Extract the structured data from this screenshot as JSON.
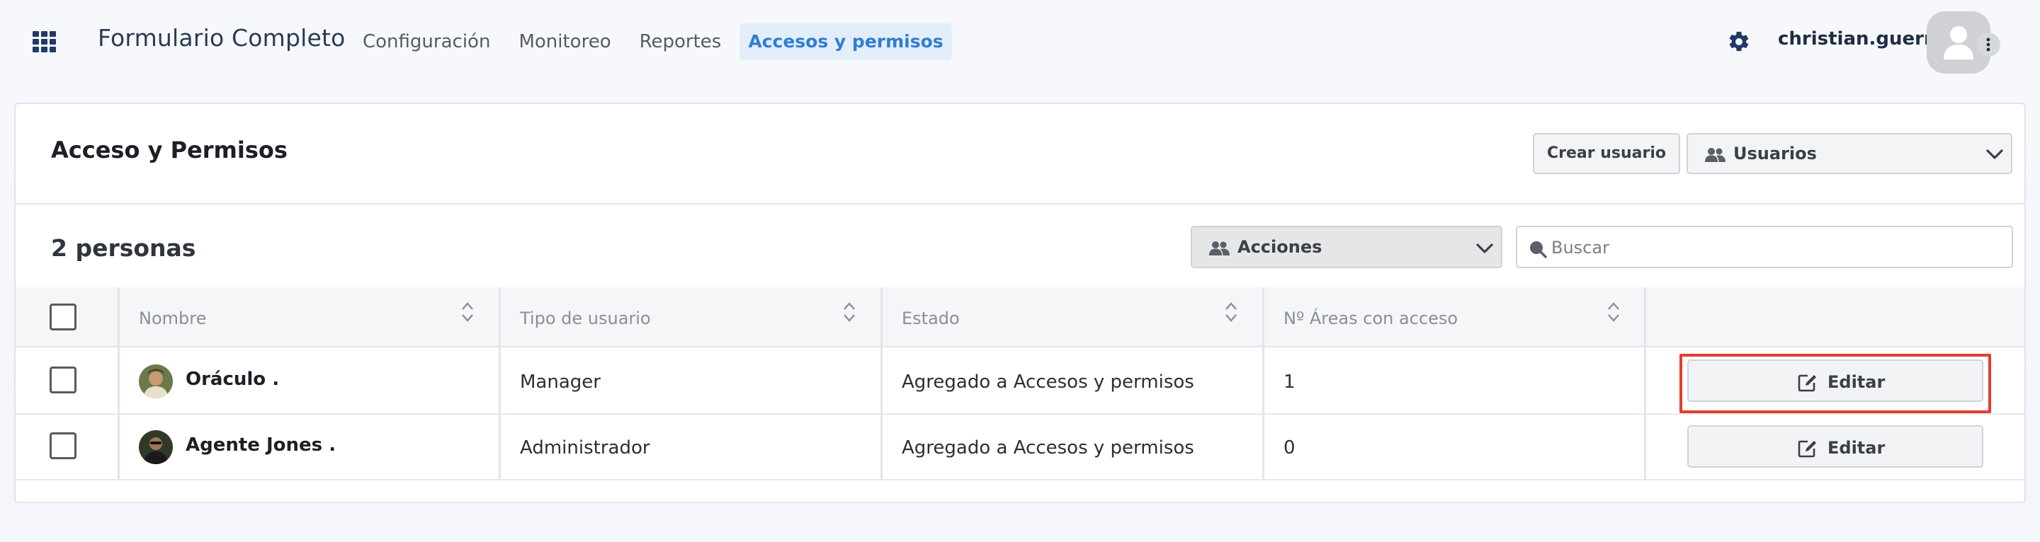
{
  "header": {
    "app_title": "Formulario Completo",
    "nav": [
      {
        "label": "Configuración",
        "active": false
      },
      {
        "label": "Monitoreo",
        "active": false
      },
      {
        "label": "Reportes",
        "active": false
      },
      {
        "label": "Accesos y permisos",
        "active": true
      }
    ],
    "username": "christian.guerra",
    "icons": [
      "apps-grid-icon",
      "gear-icon",
      "user-avatar-icon",
      "kebab-menu-icon"
    ]
  },
  "panel": {
    "title": "Acceso y Permisos",
    "create_user_label": "Crear usuario",
    "users_select": {
      "selected": "Usuarios",
      "icon": "users-icon"
    },
    "people_count": "2 personas",
    "actions_select": {
      "selected": "Acciones",
      "icon": "users-icon"
    },
    "search": {
      "placeholder": "Buscar",
      "value": ""
    }
  },
  "table": {
    "columns": [
      "Nombre",
      "Tipo de usuario",
      "Estado",
      "Nº Áreas con acceso"
    ],
    "rows": [
      {
        "name": "Oráculo .",
        "type": "Manager",
        "status": "Agregado a Accesos y permisos",
        "areas": "1",
        "action": "Editar"
      },
      {
        "name": "Agente Jones .",
        "type": "Administrador",
        "status": "Agregado a Accesos y permisos",
        "areas": "0",
        "action": "Editar"
      }
    ]
  },
  "colors": {
    "accent": "#2f7fd1",
    "active_nav_bg": "#e4eefb",
    "highlight": "#e53b2e"
  }
}
